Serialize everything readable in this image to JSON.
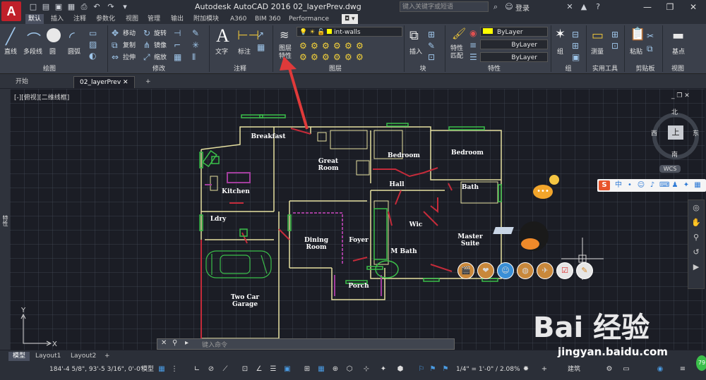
{
  "app": {
    "logo": "A",
    "title": "Autodesk AutoCAD 2016    02_layerPrev.dwg",
    "search_placeholder": "键入关键字或短语",
    "login": "登录"
  },
  "ribbon_tabs": [
    "默认",
    "插入",
    "注释",
    "参数化",
    "视图",
    "管理",
    "输出",
    "附加模块",
    "A360",
    "BIM 360",
    "Performance"
  ],
  "ribbon": {
    "draw": {
      "label": "绘图",
      "line": "直线",
      "polyline": "多段线",
      "circle": "圆",
      "arc": "圆弧"
    },
    "modify": {
      "label": "修改",
      "move": "移动",
      "rotate": "旋转",
      "copy": "复制",
      "mirror": "镜像",
      "stretch": "拉伸",
      "scale": "缩放"
    },
    "annotation": {
      "label": "注释",
      "text": "文字",
      "dimension": "标注"
    },
    "layers": {
      "label": "图层",
      "layer_props": "图层\n特性",
      "current_layer": "int-walls"
    },
    "block": {
      "label": "块",
      "insert": "插入"
    },
    "properties": {
      "label": "特性",
      "match": "特性\n匹配",
      "color": "ByLayer",
      "linetype": "ByLayer",
      "lineweight": "ByLayer"
    },
    "groups": {
      "label": "组",
      "group": "组"
    },
    "utilities": {
      "label": "实用工具",
      "measure": "测量"
    },
    "clipboard": {
      "label": "剪贴板",
      "paste": "粘贴"
    },
    "view": {
      "label": "视图",
      "base": "基点"
    }
  },
  "doc_tabs": [
    "开始",
    "02_layerPrev"
  ],
  "viewport_label": "[-][俯视][二维线框]",
  "viewcube": {
    "north": "北",
    "south": "南",
    "east": "东",
    "west": "西",
    "top": "上",
    "wcs": "WCS"
  },
  "rooms": {
    "breakfast": "Breakfast",
    "great_room": "Great\nRoom",
    "bedroom1": "Bedroom",
    "bedroom2": "Bedroom",
    "kitchen": "Kitchen",
    "hall": "Hall",
    "bath": "Bath",
    "ldry": "Ldry",
    "wic": "Wic",
    "dining": "Dining\nRoom",
    "foyer": "Foyer",
    "mbath": "M Bath",
    "master": "Master\nSuite",
    "porch": "Porch",
    "garage": "Two Car\nGarage"
  },
  "command_placeholder": "键入命令",
  "layout_tabs": [
    "模型",
    "Layout1",
    "Layout2"
  ],
  "status": {
    "coords": "184'-4 5/8\", 93'-5 3/16\", 0'-0\"",
    "model": "模型",
    "scale": "1/4\" = 1'-0\" / 2.08%",
    "workspace": "建筑"
  },
  "watermark": {
    "brand": "Bai 经验",
    "url": "jingyan.baidu.com"
  },
  "palette_label": "特性"
}
